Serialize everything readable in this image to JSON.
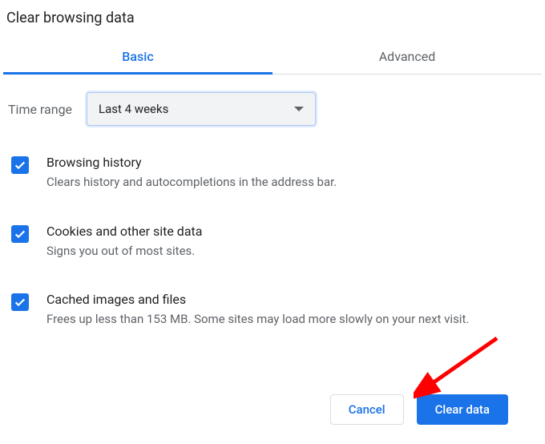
{
  "title": "Clear browsing data",
  "tabs": {
    "basic": "Basic",
    "advanced": "Advanced"
  },
  "timeRange": {
    "label": "Time range",
    "value": "Last 4 weeks"
  },
  "options": [
    {
      "title": "Browsing history",
      "desc": "Clears history and autocompletions in the address bar.",
      "checked": true
    },
    {
      "title": "Cookies and other site data",
      "desc": "Signs you out of most sites.",
      "checked": true
    },
    {
      "title": "Cached images and files",
      "desc": "Frees up less than 153 MB. Some sites may load more slowly on your next visit.",
      "checked": true
    }
  ],
  "buttons": {
    "cancel": "Cancel",
    "clear": "Clear data"
  },
  "colors": {
    "accent": "#1a73e8",
    "muted": "#5f6368",
    "annotation": "#ff0000"
  }
}
